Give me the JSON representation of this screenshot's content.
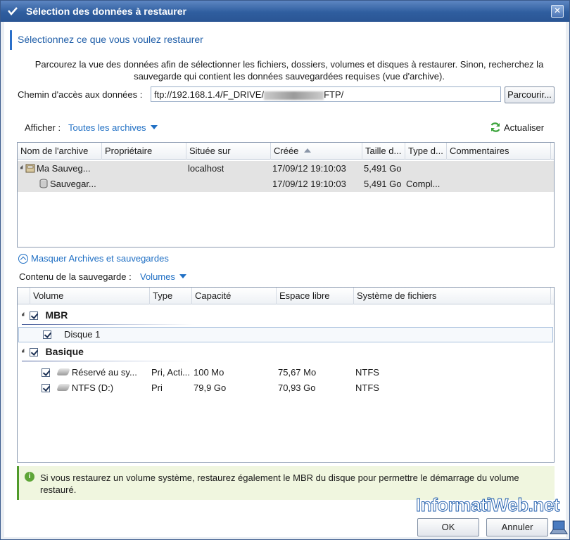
{
  "window": {
    "title": "Sélection des données à restaurer",
    "close_glyph": "✕"
  },
  "header": {
    "heading": "Sélectionnez ce que vous voulez restaurer"
  },
  "description": "Parcourez la vue des données afin de sélectionner les fichiers, dossiers, volumes et disques à restaurer. Sinon, recherchez la sauvegarde qui contient les données sauvegardées requises (vue d'archive).",
  "path": {
    "label": "Chemin d'accès aux données :",
    "value_start": "ftp://192.168.1.4/F_DRIVE/",
    "value_end": "FTP/",
    "browse_label": "Parcourir..."
  },
  "filter": {
    "show_label": "Afficher :",
    "show_value": "Toutes les archives",
    "refresh_label": "Actualiser"
  },
  "archives": {
    "columns": [
      "Nom de l'archive",
      "Propriétaire",
      "Située sur",
      "Créée",
      "Taille d...",
      "Type d...",
      "Commentaires"
    ],
    "rows": [
      {
        "name": "Ma Sauveg...",
        "owner": "",
        "location": "localhost",
        "created": "17/09/12 19:10:03",
        "size": "5,491 Go",
        "type": "",
        "comments": ""
      },
      {
        "name": "Sauvegar...",
        "owner": "",
        "location": "",
        "created": "17/09/12 19:10:03",
        "size": "5,491 Go",
        "type": "Compl...",
        "comments": ""
      }
    ]
  },
  "toggle": {
    "hide_label": "Masquer Archives et sauvegardes"
  },
  "backup_content": {
    "label": "Contenu de la sauvegarde :",
    "value": "Volumes"
  },
  "volumes": {
    "columns": [
      "Volume",
      "Type",
      "Capacité",
      "Espace libre",
      "Système de fichiers"
    ],
    "groups": [
      {
        "name": "MBR",
        "items": [
          {
            "volume": "Disque 1"
          }
        ]
      },
      {
        "name": "Basique",
        "items": [
          {
            "volume": "Réservé au sy...",
            "type": "Pri, Acti...",
            "capacity": "100 Mo",
            "free": "75,67 Mo",
            "fs": "NTFS"
          },
          {
            "volume": "NTFS (D:)",
            "type": "Pri",
            "capacity": "79,9 Go",
            "free": "70,93 Go",
            "fs": "NTFS"
          }
        ]
      }
    ]
  },
  "info": {
    "message": "Si vous restaurez un volume système, restaurez également le MBR du disque pour permettre le démarrage du volume restauré."
  },
  "footer": {
    "ok_label": "OK",
    "cancel_label": "Annuler",
    "watermark": "InformatiWeb.net"
  }
}
